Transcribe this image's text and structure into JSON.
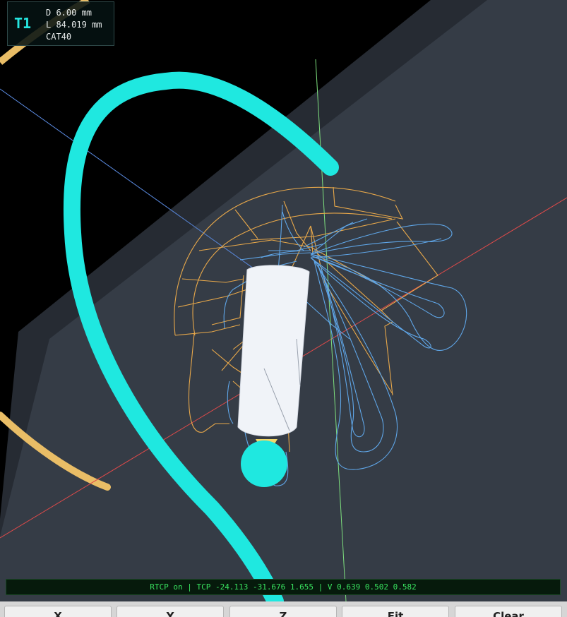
{
  "tool": {
    "id": "T1",
    "diameter": "D 6.00 mm",
    "length": "L 84.019 mm",
    "holder": "CAT40"
  },
  "status": "RTCP on | TCP -24.113 -31.676 1.655 | V 0.639 0.502 0.582",
  "buttons": [
    "X",
    "Y",
    "Z",
    "Fit",
    "Clear"
  ],
  "colors": {
    "tool_arc": "#25e6e0",
    "path_primary": "#e8a84a",
    "path_secondary": "#5fa6e8",
    "x_axis": "#e04a4a",
    "y_axis": "#7ee07e",
    "z_axis": "#5a8ae0",
    "stock_top": "#353c46",
    "stock_side": "#232830"
  }
}
